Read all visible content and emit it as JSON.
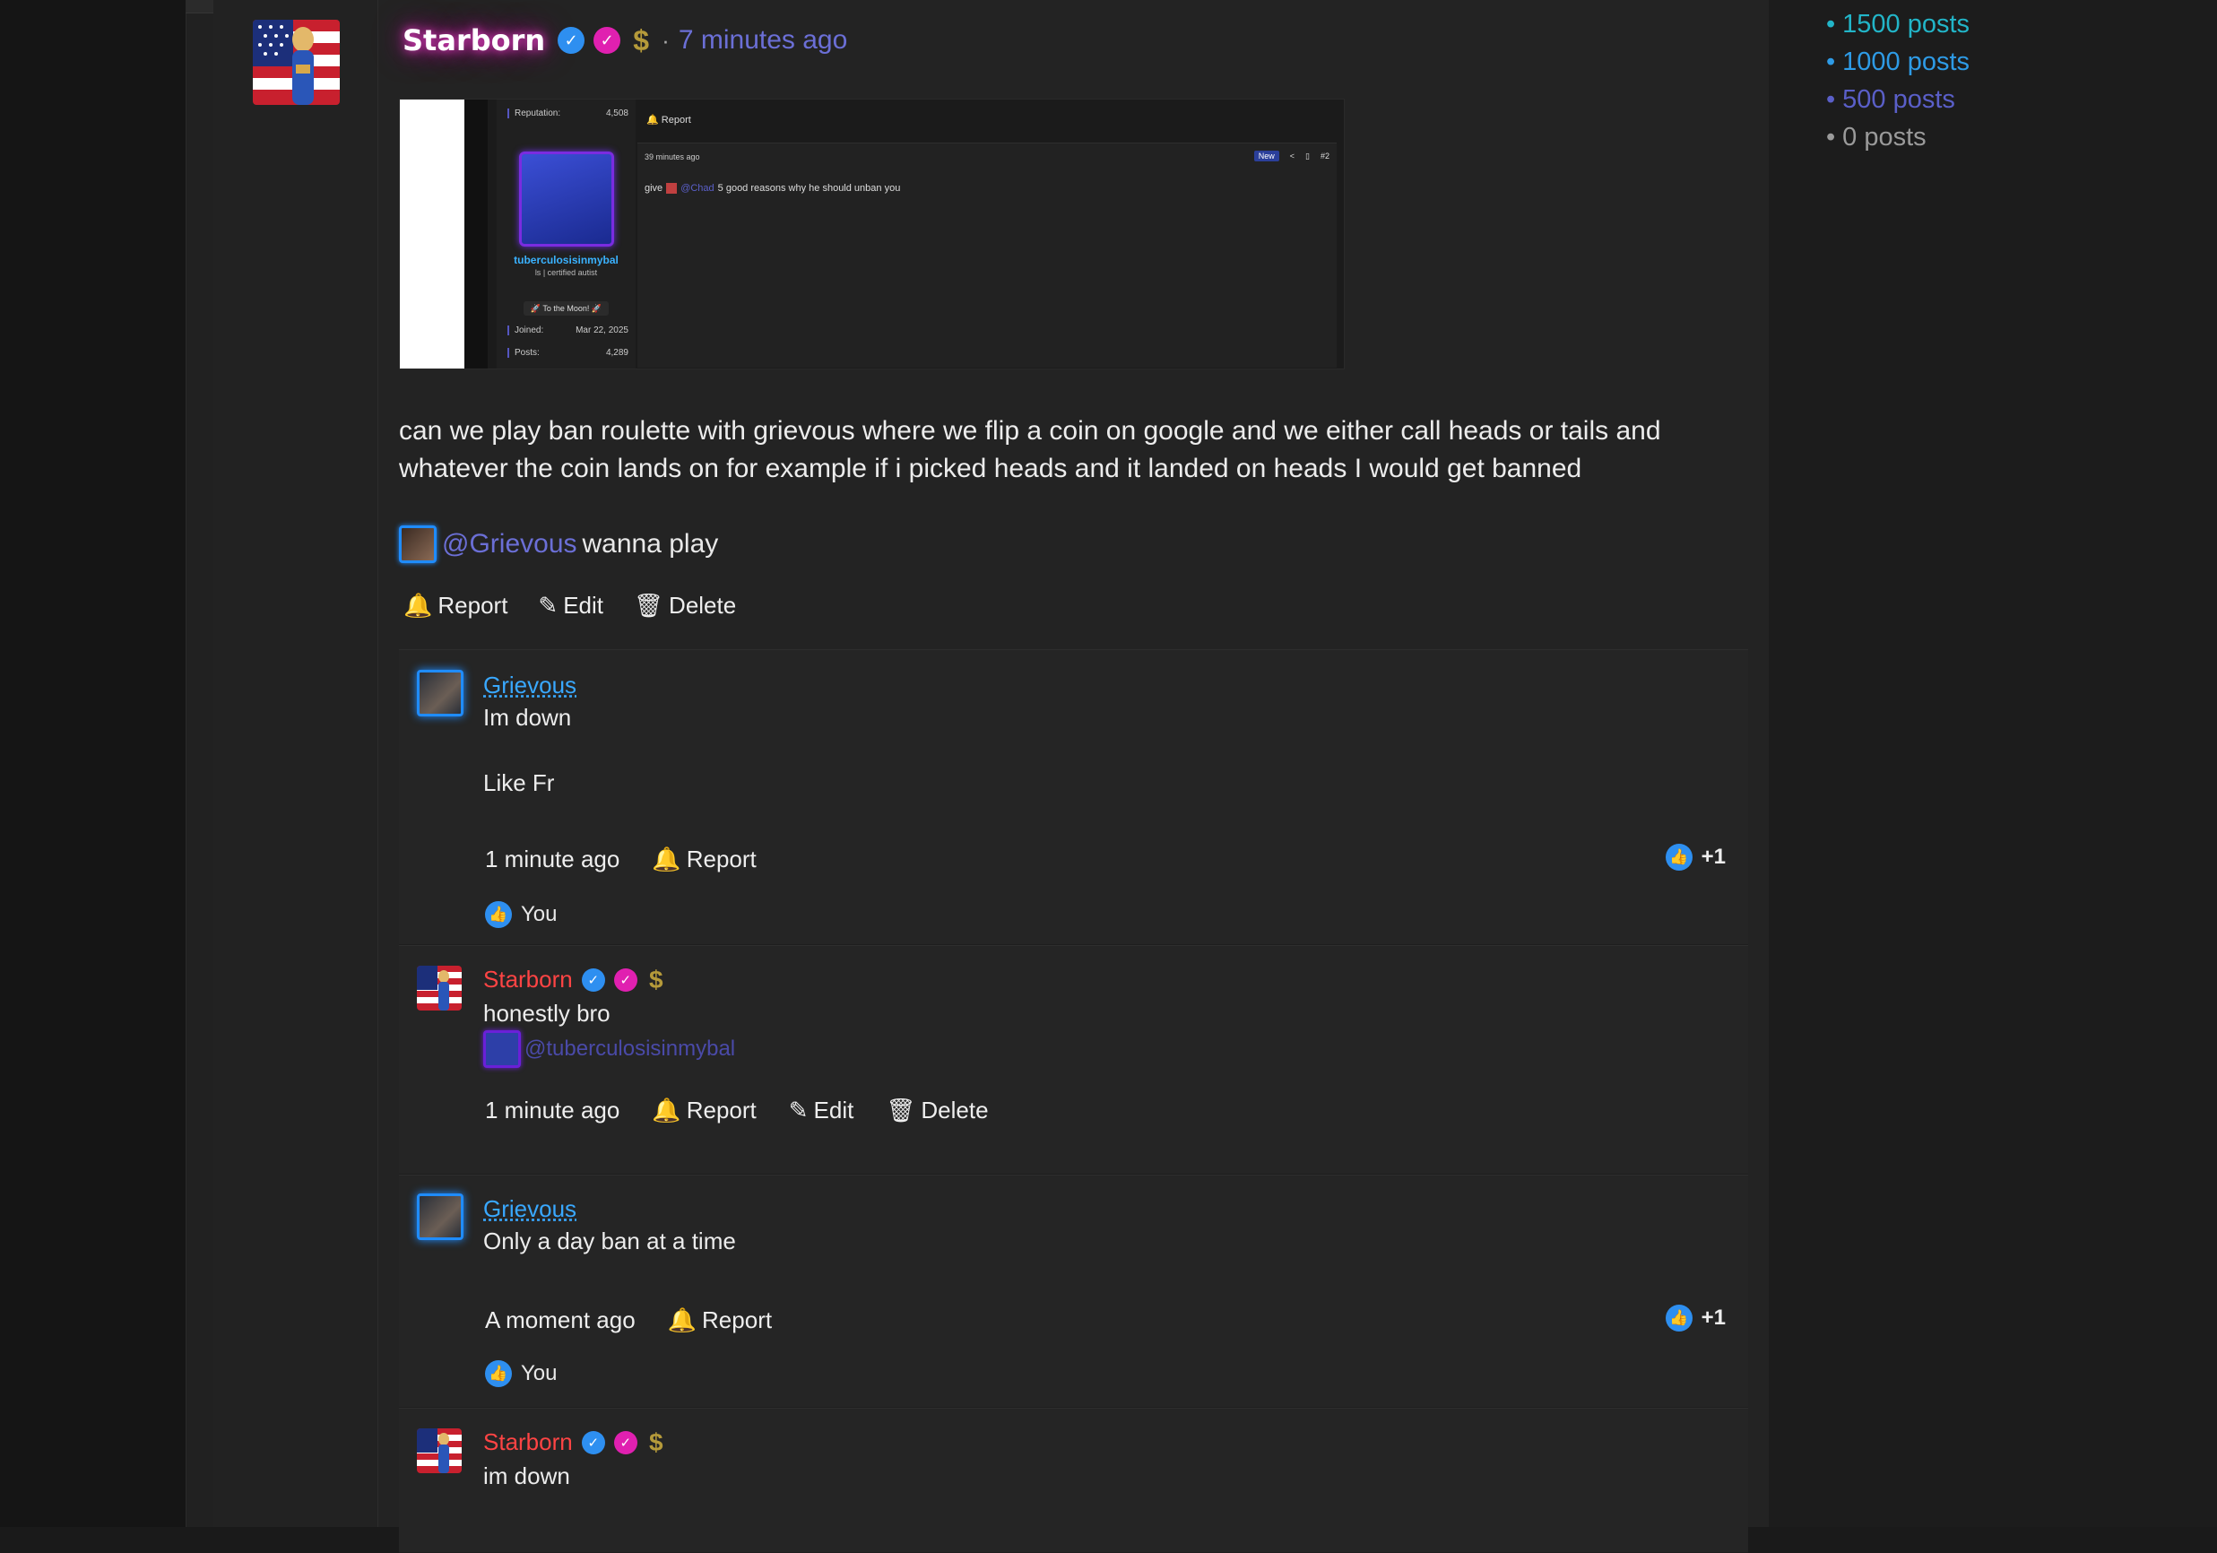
{
  "post": {
    "author": "Starborn",
    "time": "7 minutes ago",
    "separator": "·",
    "body": "can we play ban roulette with grievous where we flip a coin on google and we either call heads or tails and whatever the coin lands on for example if i picked heads and it landed on heads I would get banned",
    "mention": "@Grievous",
    "mention_tail": "wanna play",
    "actions": {
      "report": "Report",
      "edit": "Edit",
      "delete": "Delete"
    },
    "embedded": {
      "reputation_label": "Reputation:",
      "reputation": "4,508",
      "report": "Report",
      "username": "tuberculosisinmybal",
      "subtitle": "ls | certified autist",
      "moon": "🚀 To the Moon! 🚀",
      "joined_label": "Joined:",
      "joined": "Mar 22, 2025",
      "posts_label": "Posts:",
      "posts": "4,289",
      "post_time": "39 minutes ago",
      "new_badge": "New",
      "post_number": "#2",
      "post_text_pre": "give",
      "post_mention": "@Chad",
      "post_text_post": "5 good reasons why he should unban you"
    }
  },
  "replies": [
    {
      "author": "Grievous",
      "lines": [
        "Im down",
        "Like Fr"
      ],
      "time": "1 minute ago",
      "report": "Report",
      "likes": "+1",
      "liked_by": "You"
    },
    {
      "author": "Starborn",
      "text": "honestly bro",
      "mention": "@tuberculosisinmybal",
      "time": "1 minute ago",
      "report": "Report",
      "edit": "Edit",
      "delete": "Delete"
    },
    {
      "author": "Grievous",
      "text": "Only a day ban at a time",
      "time": "A moment ago",
      "report": "Report",
      "likes": "+1",
      "liked_by": "You"
    },
    {
      "author": "Starborn",
      "text": "im down"
    }
  ],
  "sidebar_tiers": [
    {
      "label": "1500 posts",
      "color": "#22b5c8"
    },
    {
      "label": "1000 posts",
      "color": "#2e9be6"
    },
    {
      "label": "500 posts",
      "color": "#5a5fc8"
    },
    {
      "label": "0 posts",
      "color": "#9a9a9a"
    }
  ],
  "bullet": "•"
}
